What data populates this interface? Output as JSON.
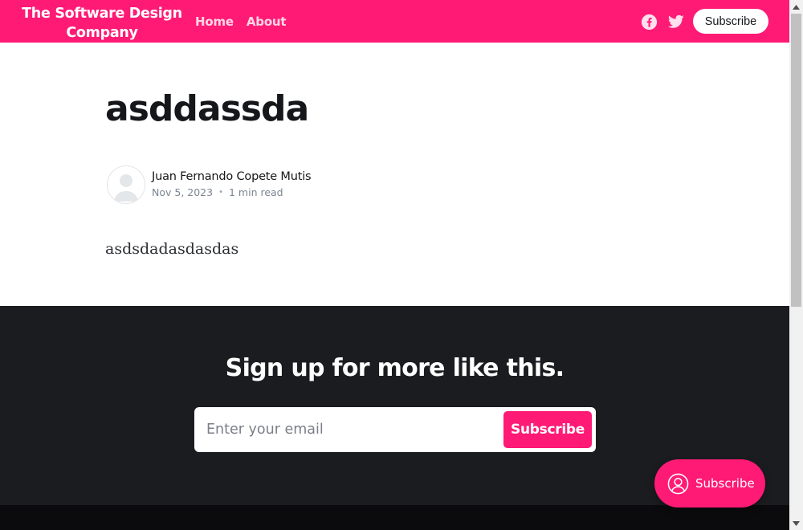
{
  "header": {
    "logo": "The Software Design Company",
    "nav": [
      {
        "label": "Home"
      },
      {
        "label": "About"
      }
    ],
    "social_icons": [
      "facebook-icon",
      "twitter-icon"
    ],
    "subscribe_label": "Subscribe"
  },
  "article": {
    "title": "asddassda",
    "author": "Juan Fernando Copete Mutis",
    "date": "Nov 5, 2023",
    "separator": "•",
    "read_time": "1 min read",
    "body": "asdsdadasdasdas"
  },
  "signup": {
    "title": "Sign up for more like this.",
    "email_placeholder": "Enter your email",
    "button_label": "Subscribe"
  },
  "portal": {
    "label": "Subscribe",
    "icon": "user-circle-icon"
  },
  "colors": {
    "accent": "#ff1a75",
    "dark_section": "#1b1c20",
    "text": "#15171a"
  }
}
